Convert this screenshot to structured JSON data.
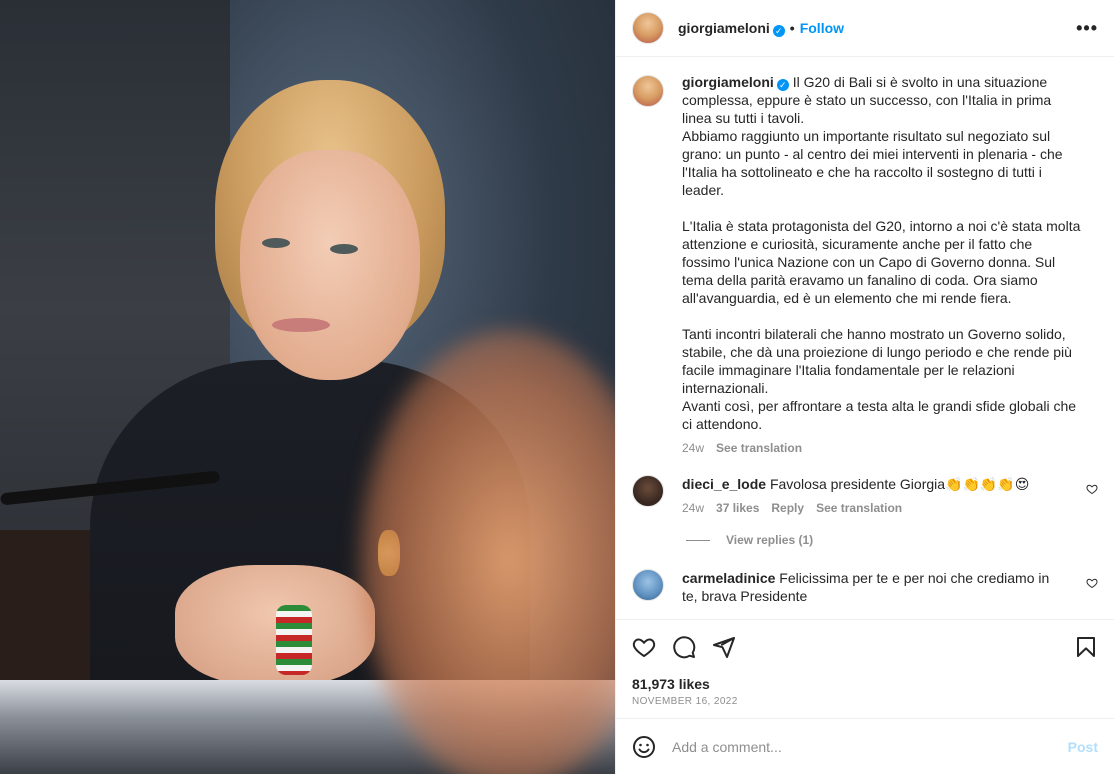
{
  "post": {
    "username": "giorgiameloni",
    "verified_symbol": "✓",
    "follow_label": "Follow",
    "separator": "•",
    "more_label": "•••",
    "photo_alt": "Post photo"
  },
  "caption": {
    "username": "giorgiameloni",
    "text": "Il G20 di Bali si è svolto in una situazione complessa, eppure è stato un successo, con l'Italia in prima linea su tutti i tavoli.\nAbbiamo raggiunto un importante risultato sul negoziato sul grano: un punto - al centro dei miei interventi in plenaria - che l'Italia ha sottolineato e che ha raccolto il sostegno di tutti i leader.\n\nL'Italia è stata protagonista del G20, intorno a noi c'è stata molta attenzione e curiosità, sicuramente anche per il fatto che fossimo l'unica Nazione con un Capo di Governo donna. Sul tema della parità eravamo un fanalino di coda. Ora siamo all'avanguardia, ed è un elemento che mi rende fiera.\n\nTanti incontri bilaterali che hanno mostrato un Governo solido, stabile, che dà una proiezione di lungo periodo e che rende più facile immaginare l'Italia fondamentale per le relazioni internazionali.\nAvanti così, per affrontare a testa alta le grandi sfide globali che ci attendono.",
    "age": "24w",
    "see_translation": "See translation"
  },
  "comments": [
    {
      "username": "dieci_e_lode",
      "text": "Favolosa presidente Giorgia👏👏👏👏😍",
      "age": "24w",
      "likes": "37 likes",
      "reply": "Reply",
      "see_translation": "See translation",
      "view_replies": "View replies (1)"
    },
    {
      "username": "carmeladinice",
      "text": "Felicissima per te e per noi che crediamo in te, brava Presidente"
    }
  ],
  "engagement": {
    "likes": "81,973 likes",
    "date": "NOVEMBER 16, 2022"
  },
  "add_comment": {
    "placeholder": "Add a comment...",
    "post_label": "Post"
  },
  "colors": {
    "accent": "#0095f6",
    "post_disabled": "#b2dffc",
    "secondary_text": "#8e8e8e"
  },
  "icons": [
    "heart-icon",
    "comment-icon",
    "share-icon",
    "bookmark-icon",
    "emoji-icon",
    "more-icon",
    "verified-badge-icon"
  ]
}
